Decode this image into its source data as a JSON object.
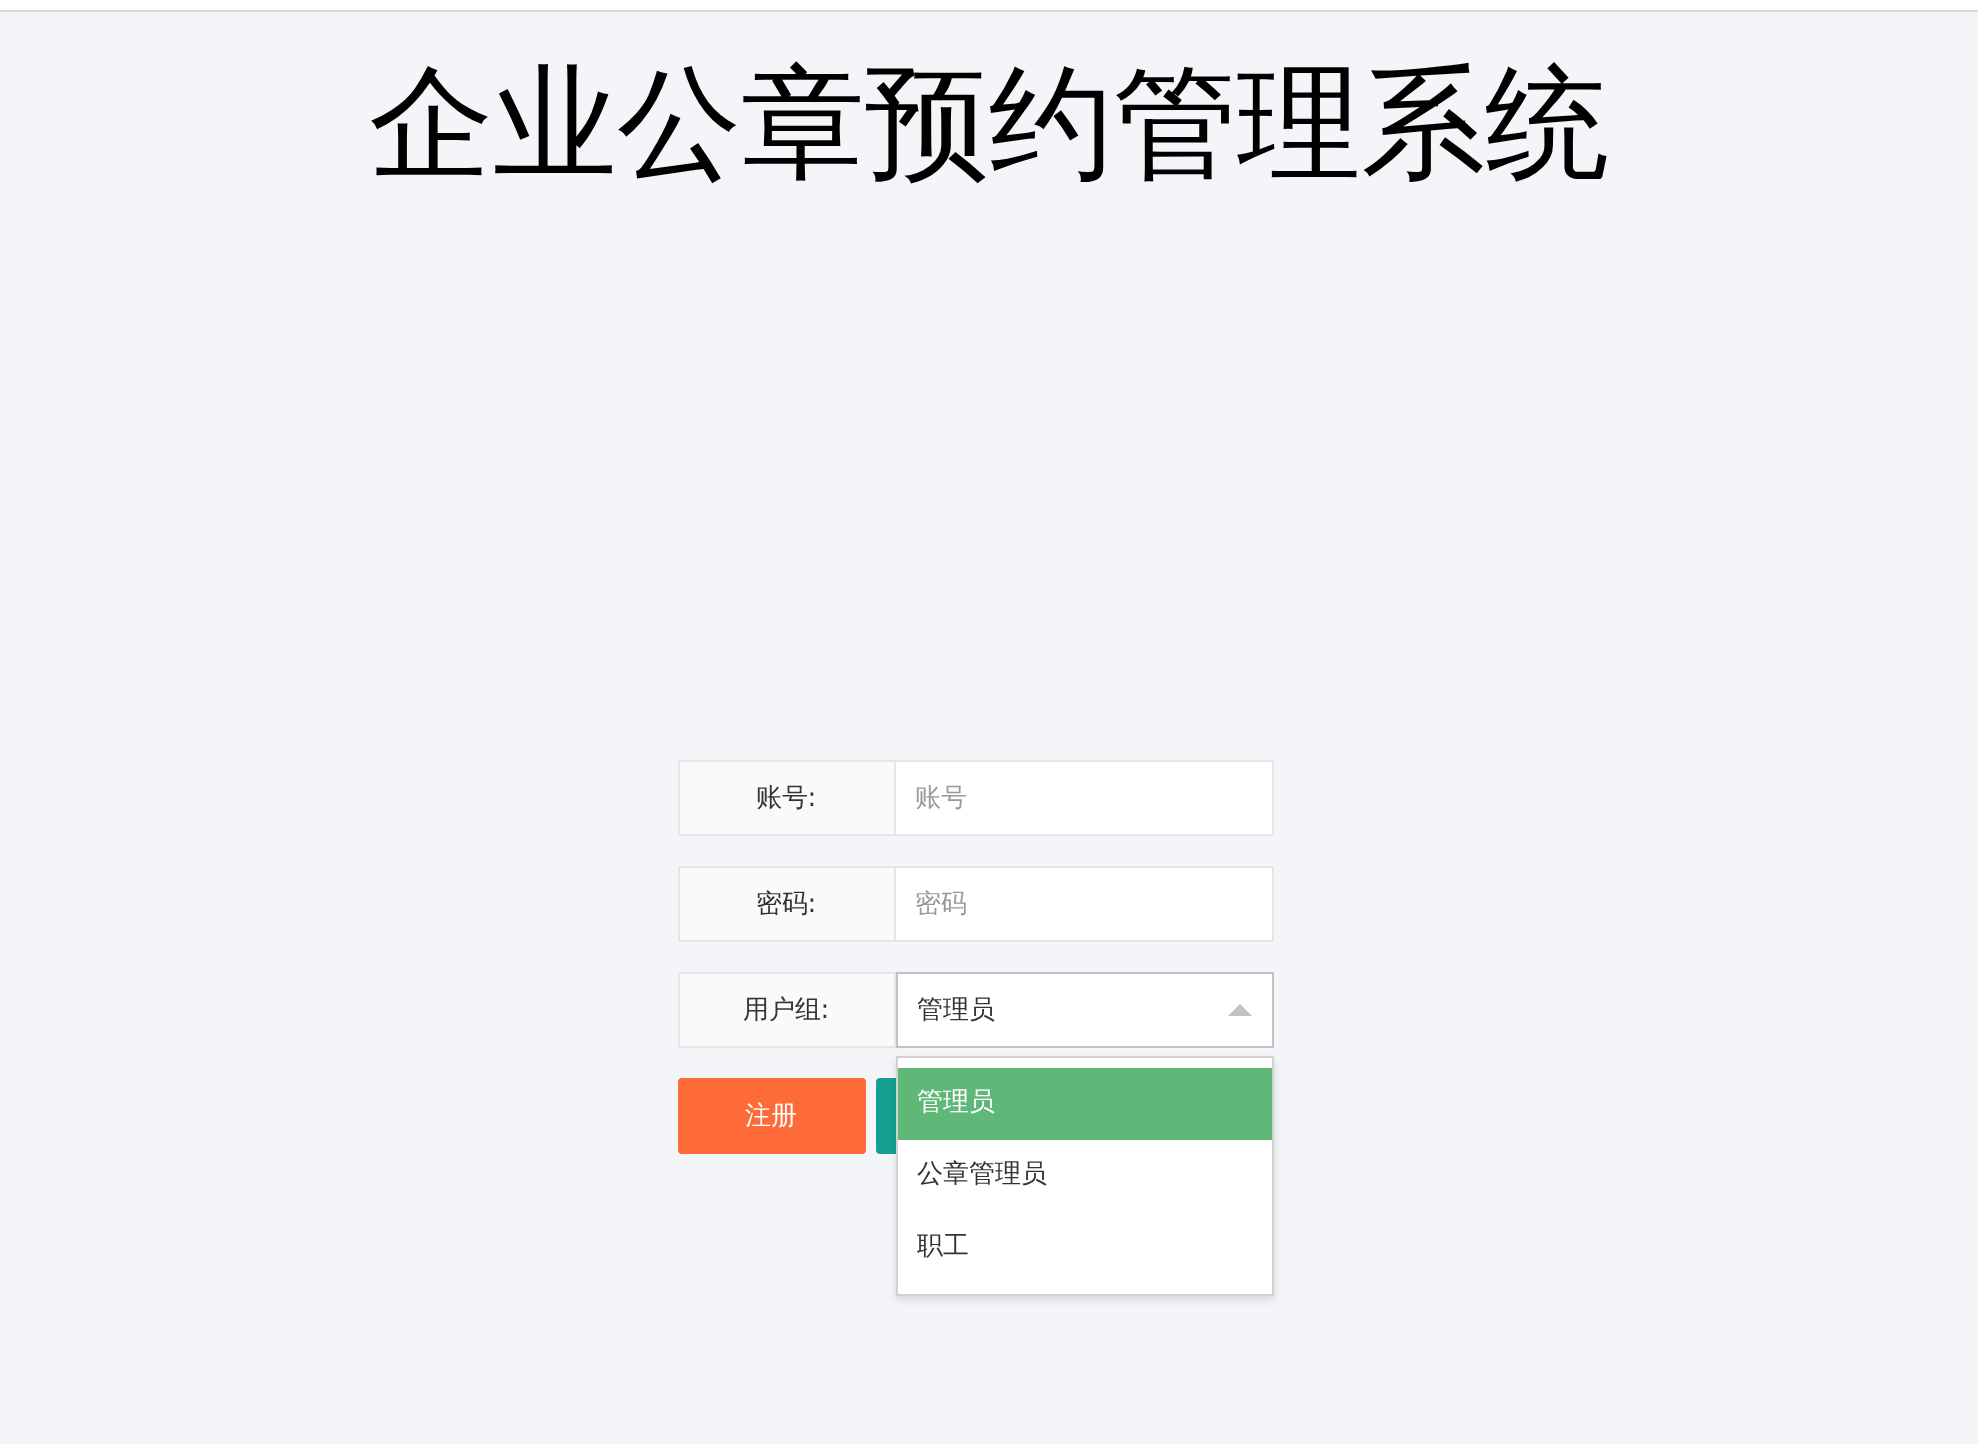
{
  "title": "企业公章预约管理系统",
  "form": {
    "fields": [
      {
        "kind": "text",
        "label": "账号:",
        "placeholder": "账号"
      },
      {
        "kind": "text",
        "label": "密码:",
        "placeholder": "密码"
      },
      {
        "kind": "select",
        "label": "用户组:",
        "value": "管理员",
        "expanded": true,
        "options": [
          {
            "label": "管理员",
            "selected": true
          },
          {
            "label": "公章管理员",
            "selected": false
          },
          {
            "label": "职工",
            "selected": false
          }
        ]
      }
    ],
    "buttons": [
      {
        "kind": "register",
        "label": "注册"
      },
      {
        "kind": "login"
      }
    ]
  }
}
